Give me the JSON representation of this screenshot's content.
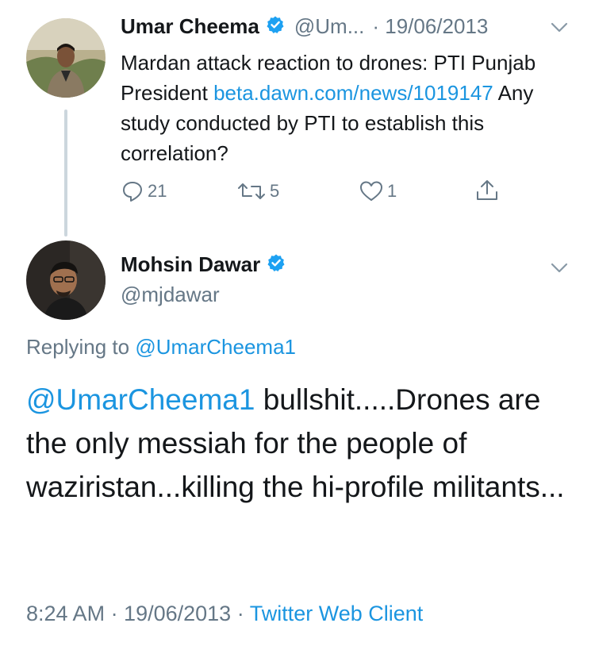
{
  "tweet1": {
    "author_name": "Umar Cheema",
    "author_handle": "@Um...",
    "date": "· 19/06/2013",
    "text_part1": "Mardan attack reaction to drones: PTI Punjab President ",
    "link": "beta.dawn.com/news/1019147",
    "text_part2": " Any study conducted by PTI to establish this correlation?",
    "actions": {
      "replies": "21",
      "retweets": "5",
      "likes": "1"
    }
  },
  "tweet2": {
    "author_name": "Mohsin Dawar",
    "author_handle": "@mjdawar",
    "replying_prefix": "Replying to ",
    "replying_handle": "@UmarCheema1",
    "text_mention": "@UmarCheema1",
    "text_rest": " bullshit.....Drones are the only messiah for the people of waziristan...killing the hi-profile militants...",
    "time": "8:24 AM",
    "date": " · 19/06/2013 · ",
    "client": "Twitter Web Client"
  },
  "icons": {
    "verified": "verified-badge-icon",
    "caret": "chevron-down-icon",
    "reply": "reply-icon",
    "retweet": "retweet-icon",
    "like": "heart-icon",
    "share": "share-icon"
  },
  "colors": {
    "link": "#1b95e0",
    "muted": "#657786",
    "text": "#14171a",
    "thread_line": "#ccd6dd"
  }
}
